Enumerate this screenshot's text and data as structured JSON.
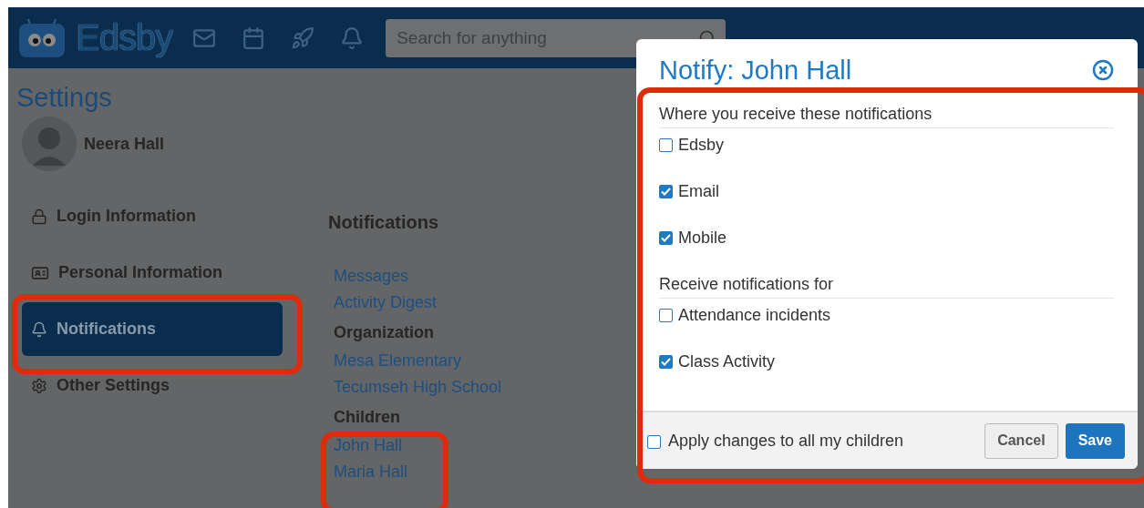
{
  "header": {
    "logo": "Edsby",
    "search": {
      "placeholder": "Search for anything"
    }
  },
  "page": {
    "title": "Settings",
    "user": "Neera Hall"
  },
  "nav": [
    {
      "label": "Login Information",
      "kind": "lock",
      "selected": false
    },
    {
      "label": "Personal Information",
      "kind": "card",
      "selected": false
    },
    {
      "label": "Notifications",
      "kind": "bell",
      "selected": true
    },
    {
      "label": "Other Settings",
      "kind": "gear",
      "selected": false
    }
  ],
  "notifications": {
    "heading": "Notifications",
    "items": [
      {
        "kind": "link",
        "label": "Messages"
      },
      {
        "kind": "link",
        "label": "Activity Digest"
      },
      {
        "kind": "heading",
        "label": "Organization"
      },
      {
        "kind": "link",
        "label": "Mesa Elementary"
      },
      {
        "kind": "link",
        "label": "Tecumseh High School"
      },
      {
        "kind": "heading",
        "label": "Children"
      },
      {
        "kind": "link",
        "label": "John Hall"
      },
      {
        "kind": "link",
        "label": "Maria Hall"
      }
    ]
  },
  "dialog": {
    "title": "Notify: John Hall",
    "sections": [
      {
        "label": "Where you receive these notifications",
        "options": [
          {
            "label": "Edsby",
            "checked": false
          },
          {
            "label": "Email",
            "checked": true
          },
          {
            "label": "Mobile",
            "checked": true
          }
        ]
      },
      {
        "label": "Receive notifications for",
        "options": [
          {
            "label": "Attendance incidents",
            "checked": false
          },
          {
            "label": "Class Activity",
            "checked": true
          }
        ]
      }
    ],
    "apply_all": {
      "label": "Apply changes to all my children",
      "checked": false
    },
    "buttons": [
      {
        "label": "Cancel",
        "kind": "secondary"
      },
      {
        "label": "Save",
        "kind": "primary"
      }
    ]
  }
}
